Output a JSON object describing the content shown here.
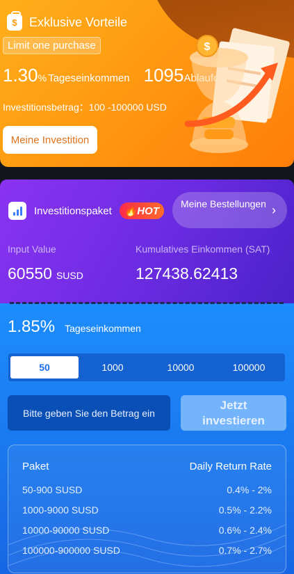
{
  "promo": {
    "title": "Exklusive Vorteile",
    "limit_badge": "Limit one purchase",
    "daily_rate": "1.30",
    "daily_rate_unit": "%",
    "daily_rate_label": "Tageseinkommen",
    "expiry_value": "1095",
    "expiry_label": "Ablaufdatum",
    "amount_label": "Investitionsbetrag：100 -100000 USD",
    "my_investment_button": "Meine Investition"
  },
  "package": {
    "title": "Investitionspaket",
    "hot_badge": "HOT",
    "orders_button": "Meine Bestellungen",
    "orders_chevron": "›",
    "input_value_label": "Input Value",
    "input_value": "60550",
    "input_value_unit": "SUSD",
    "cumulative_label": "Kumulatives Einkommen (SAT)",
    "cumulative_value": "127438.62413"
  },
  "invest": {
    "rate": "1.85%",
    "rate_label": "Tageseinkommen",
    "tabs": [
      "50",
      "1000",
      "10000",
      "100000"
    ],
    "active_tab": 0,
    "amount_placeholder": "Bitte geben Sie den Betrag ein",
    "invest_button": "Jetzt investieren"
  },
  "table": {
    "header_package": "Paket",
    "header_rate": "Daily Return Rate",
    "rows": [
      {
        "package": "50-900 SUSD",
        "rate": "0.4% - 2%"
      },
      {
        "package": "1000-9000 SUSD",
        "rate": "0.5% - 2.2%"
      },
      {
        "package": "10000-90000 SUSD",
        "rate": "0.6% - 2.4%"
      },
      {
        "package": "100000-900000 SUSD",
        "rate": "0.7% - 2.7%"
      }
    ]
  },
  "colors": {
    "orange": "#ff9a10",
    "purple": "#6a2be0",
    "blue": "#1a78ee",
    "hot": "#ff2a4a"
  },
  "icons": [
    "money-bag-icon",
    "chart-bars-icon",
    "flame-icon",
    "chevron-right-icon",
    "hourglass-coins-illustration"
  ]
}
